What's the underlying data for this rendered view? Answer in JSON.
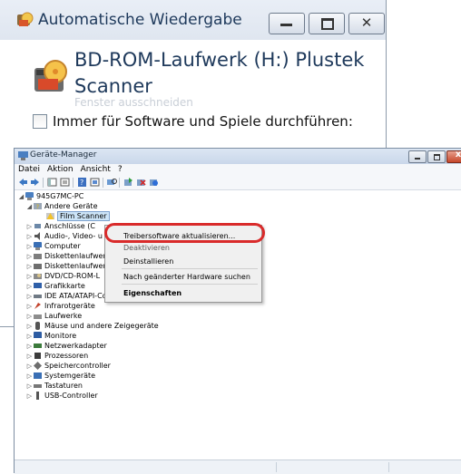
{
  "autoplay": {
    "title": "Automatische Wiedergabe",
    "device_name": "BD-ROM-Laufwerk (H:) Plustek Scanner",
    "faded_text": "Fenster ausschneiden",
    "checkbox_label": "Immer für Software und Spiele durchführen:",
    "checkbox_checked": false
  },
  "device_manager": {
    "title": "Geräte-Manager",
    "menu": [
      "Datei",
      "Aktion",
      "Ansicht",
      "?"
    ],
    "tree": {
      "root": "945G7MC-PC",
      "other_devices": "Andere Geräte",
      "selected_device": "Film Scanner",
      "categories": [
        "Anschlüsse (COM & LPT)",
        "Audio-, Video- und Gamecontroller",
        "Computer",
        "Diskettenlaufwerke",
        "Diskettenlaufwerkcontroller",
        "DVD/CD-ROM-Laufwerke",
        "Grafikkarte",
        "IDE ATA/ATAPI-Controller",
        "Infrarotgeräte",
        "Laufwerke",
        "Mäuse und andere Zeigegeräte",
        "Monitore",
        "Netzwerkadapter",
        "Prozessoren",
        "Speichercontroller",
        "Systemgeräte",
        "Tastaturen",
        "USB-Controller"
      ],
      "visible_categories": [
        "Anschlüsse (C",
        "Audio-, Video- u",
        "Computer",
        "Diskettenlaufwer",
        "Diskettenlaufwer",
        "DVD/CD-ROM-L",
        "Grafikkarte",
        "IDE ATA/ATAPI-Controller",
        "Infrarotgeräte",
        "Laufwerke",
        "Mäuse und andere Zeigegeräte",
        "Monitore",
        "Netzwerkadapter",
        "Prozessoren",
        "Speichercontroller",
        "Systemgeräte",
        "Tastaturen",
        "USB-Controller"
      ]
    }
  },
  "context_menu": {
    "update_driver": "Treibersoftware aktualisieren...",
    "disable": "Deaktivieren",
    "uninstall": "Deinstallieren",
    "scan_hardware": "Nach geänderter Hardware suchen",
    "properties": "Eigenschaften",
    "highlight_color": "#d92b2b"
  },
  "colors": {
    "title_text": "#1e395b",
    "selection": "#cce4f7"
  }
}
